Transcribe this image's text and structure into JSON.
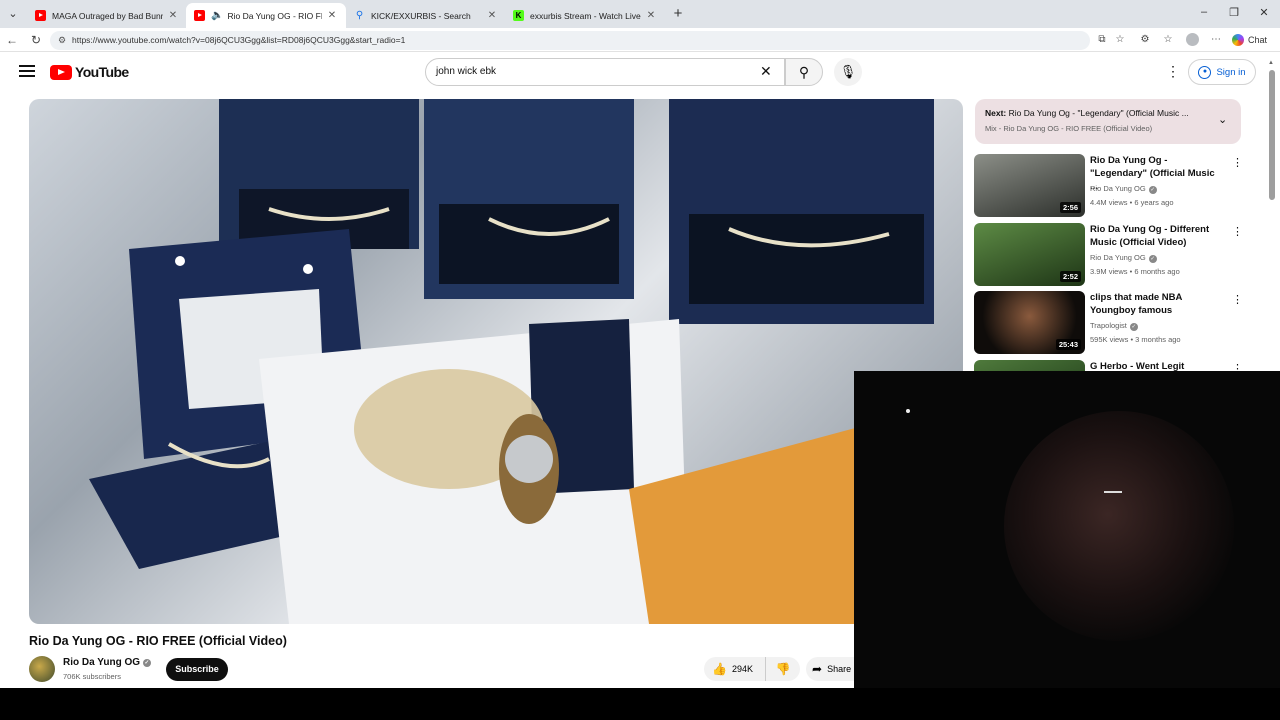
{
  "browser": {
    "tabs": [
      {
        "title": "MAGA Outraged by Bad Bunny's S",
        "favicon": "youtube-icon",
        "active": false,
        "audio": false
      },
      {
        "title": "Rio Da Yung OG - RIO FREE (O",
        "favicon": "youtube-icon",
        "active": true,
        "audio": true
      },
      {
        "title": "KICK/EXXURBIS - Search",
        "favicon": "search-icon",
        "active": false,
        "audio": false
      },
      {
        "title": "exxurbis Stream - Watch Live on K",
        "favicon": "kick-icon",
        "active": false,
        "audio": false
      }
    ],
    "url": "https://www.youtube.com/watch?v=08j6QCU3Ggg&list=RD08j6QCU3Ggg&start_radio=1",
    "chat_label": "Chat"
  },
  "youtube": {
    "logo_text": "YouTube",
    "search_query": "john wick ebk",
    "sign_in_label": "Sign in",
    "video": {
      "title": "Rio Da Yung OG - RIO FREE (Official Video)",
      "channel": "Rio Da Yung OG",
      "subscribers": "706K subscribers",
      "subscribe_label": "Subscribe",
      "likes": "294K",
      "share_label": "Share"
    },
    "next": {
      "prefix": "Next:",
      "title": "Rio Da Yung Og - \"Legendary\" (Official Music ...",
      "mix": "Mix - Rio Da Yung OG - RIO FREE (Official Video)"
    },
    "recommendations": [
      {
        "title": "Rio Da Yung Og - \"Legendary\" (Official Music ...",
        "channel": "Rio Da Yung OG",
        "verified": true,
        "views": "4.4M views",
        "age": "6 years ago",
        "duration": "2:56",
        "thumb_colors": [
          "#6b6e66",
          "#2c2f2b"
        ]
      },
      {
        "title": "Rio Da Yung Og - Different Music (Official Video)",
        "channel": "Rio Da Yung OG",
        "verified": true,
        "views": "3.9M views",
        "age": "6 months ago",
        "duration": "2:52",
        "thumb_colors": [
          "#3f6a2a",
          "#1e3516"
        ]
      },
      {
        "title": "clips that made NBA Youngboy famous",
        "channel": "Trapologist",
        "verified": true,
        "views": "595K views",
        "age": "3 months ago",
        "duration": "25:43",
        "thumb_colors": [
          "#4a3426",
          "#0f0c0a"
        ]
      },
      {
        "title": "G Herbo - Went Legit (Official",
        "channel": "",
        "verified": false,
        "views": "",
        "age": "",
        "duration": "",
        "thumb_colors": [
          "#2f5a2a",
          "#153012"
        ]
      }
    ]
  }
}
